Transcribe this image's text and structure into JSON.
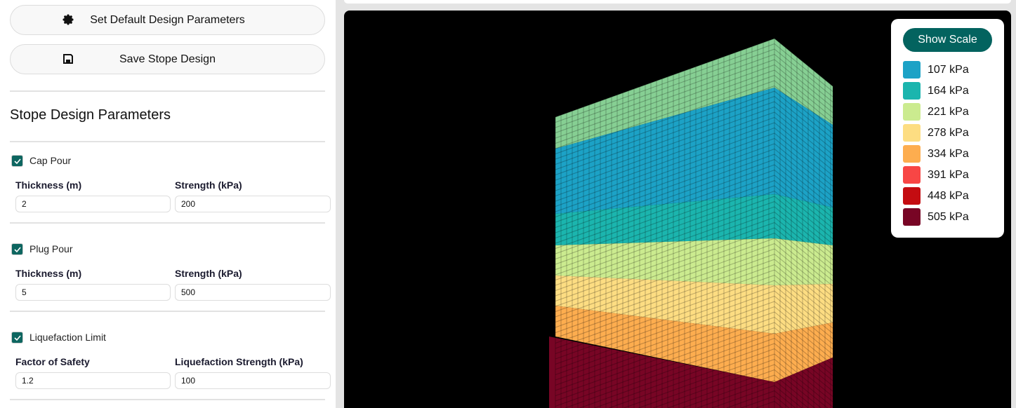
{
  "buttons": {
    "default_label": "Set Default Design Parameters",
    "default_icon": "gear-icon",
    "save_label": "Save Stope Design",
    "save_icon": "floppy-disk-icon"
  },
  "section_title": "Stope Design Parameters",
  "sections": [
    {
      "label": "Cap Pour",
      "checked": true,
      "fields": [
        {
          "label": "Thickness (m)",
          "value": "2"
        },
        {
          "label": "Strength (kPa)",
          "value": "200"
        }
      ]
    },
    {
      "label": "Plug Pour",
      "checked": true,
      "fields": [
        {
          "label": "Thickness (m)",
          "value": "5"
        },
        {
          "label": "Strength (kPa)",
          "value": "500"
        }
      ]
    },
    {
      "label": "Liquefaction Limit",
      "checked": true,
      "fields": [
        {
          "label": "Factor of Safety",
          "value": "1.2"
        },
        {
          "label": "Liquefaction Strength (kPa)",
          "value": "100"
        }
      ]
    }
  ],
  "legend": {
    "button": "Show Scale",
    "items": [
      {
        "label": "107 kPa",
        "color": "#1ca2c6"
      },
      {
        "label": "164 kPa",
        "color": "#1bb5ae"
      },
      {
        "label": "221 kPa",
        "color": "#cbeb8f"
      },
      {
        "label": "278 kPa",
        "color": "#fddd82"
      },
      {
        "label": "334 kPa",
        "color": "#fdad4f"
      },
      {
        "label": "391 kPa",
        "color": "#f84645"
      },
      {
        "label": "448 kPa",
        "color": "#c40c11"
      },
      {
        "label": "505 kPa",
        "color": "#780525"
      }
    ]
  },
  "model": {
    "top_color": "#86cf93"
  }
}
